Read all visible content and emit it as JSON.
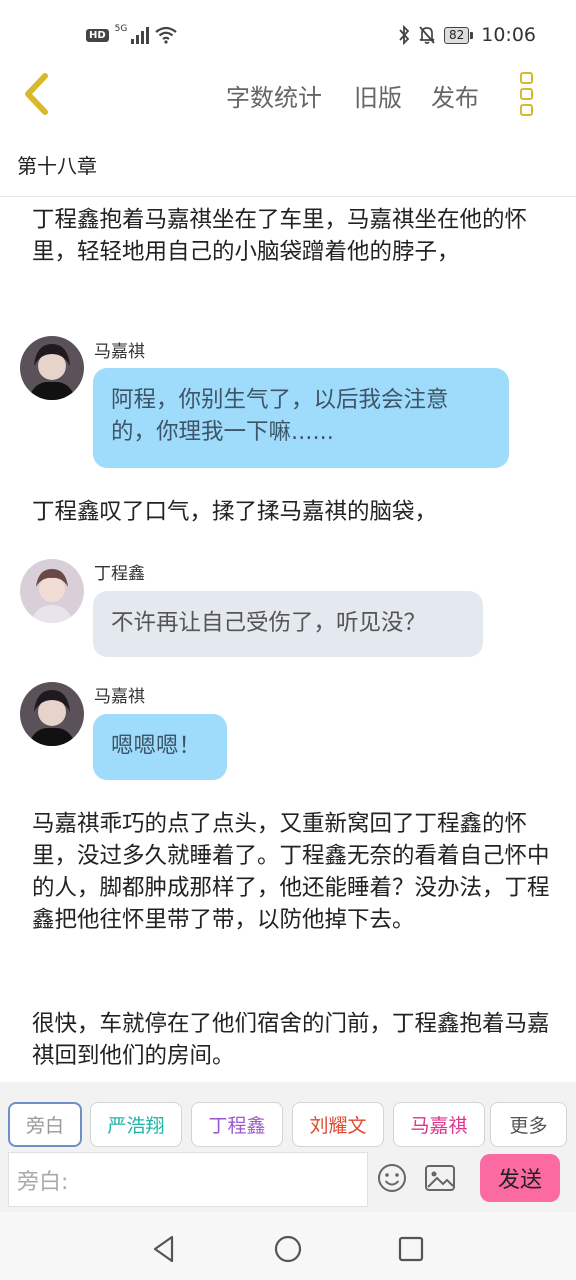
{
  "status_bar": {
    "hd": "HD",
    "network": "5G",
    "battery": "82",
    "time": "10:06",
    "icons": [
      "hd-icon",
      "signal-icon",
      "wifi-icon",
      "bluetooth-icon",
      "mute-bell-icon",
      "battery-icon"
    ]
  },
  "toolbar": {
    "back_icon": "chevron-left-icon",
    "word_count_label": "字数统计",
    "old_version_label": "旧版",
    "publish_label": "发布",
    "more_icon": "vertical-dots-icon",
    "accent": "#d8b92b"
  },
  "chapter": {
    "title": "第十八章"
  },
  "story": {
    "narration_1": "丁程鑫抱着马嘉祺坐在了车里，马嘉祺坐在他的怀里，轻轻地用自己的小脑袋蹭着他的脖子，",
    "message_1": {
      "speaker": "马嘉祺",
      "text": "阿程，你别生气了，以后我会注意的，你理我一下嘛......",
      "bubble_color": "#9fdcfc"
    },
    "narration_2": "丁程鑫叹了口气，揉了揉马嘉祺的脑袋，",
    "message_2": {
      "speaker": "丁程鑫",
      "text": "不许再让自己受伤了，听见没？",
      "bubble_color": "#e4e8ef"
    },
    "message_3": {
      "speaker": "马嘉祺",
      "text": "嗯嗯嗯！",
      "bubble_color": "#9fdcfc"
    },
    "narration_3": "马嘉祺乖巧的点了点头，又重新窝回了丁程鑫的怀里，没过多久就睡着了。丁程鑫无奈的看着自己怀中的人，脚都肿成那样了，他还能睡着？没办法，丁程鑫把他往怀里带了带，以防他掉下去。",
    "narration_4": "很快，车就停在了他们宿舍的门前，丁程鑫抱着马嘉祺回到他们的房间。"
  },
  "composer": {
    "roles": [
      {
        "label": "旁白",
        "color": "#999999"
      },
      {
        "label": "严浩翔",
        "color": "#1fb5a7"
      },
      {
        "label": "丁程鑫",
        "color": "#9b59d0"
      },
      {
        "label": "刘耀文",
        "color": "#e04a2f"
      },
      {
        "label": "马嘉祺",
        "color": "#e0338c"
      }
    ],
    "more_label": "更多",
    "input_placeholder": "旁白:",
    "emoji_icon": "smiley-icon",
    "image_icon": "image-icon",
    "send_label": "发送",
    "send_color": "#fb6aa0"
  },
  "nav": {
    "icons": [
      "back-triangle-icon",
      "home-circle-icon",
      "recents-square-icon"
    ]
  }
}
